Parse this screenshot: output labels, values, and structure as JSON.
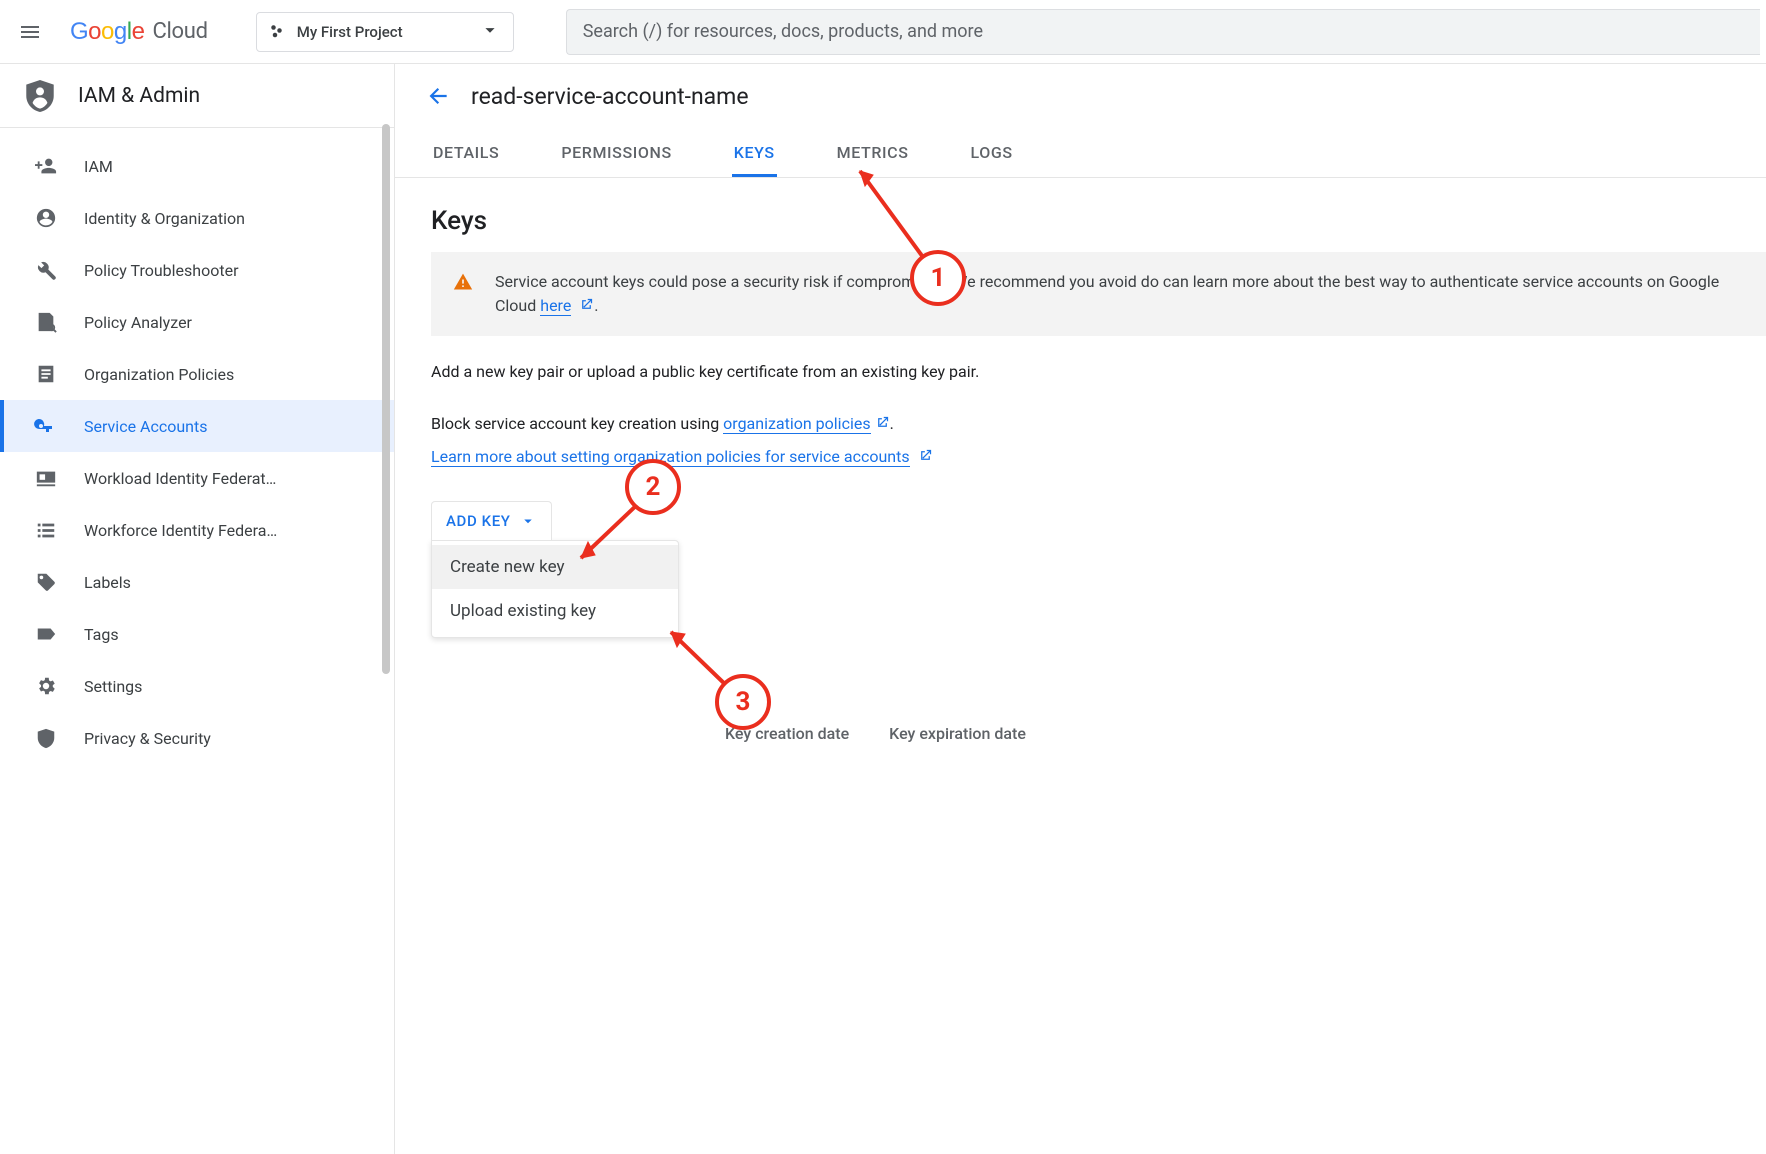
{
  "header": {
    "logo_text_google": "Google",
    "logo_text_cloud": "Cloud",
    "project_label": "My First Project",
    "search_placeholder": "Search (/) for resources, docs, products, and more"
  },
  "section": {
    "title": "IAM & Admin"
  },
  "sidebar": {
    "items": [
      {
        "label": "IAM"
      },
      {
        "label": "Identity & Organization"
      },
      {
        "label": "Policy Troubleshooter"
      },
      {
        "label": "Policy Analyzer"
      },
      {
        "label": "Organization Policies"
      },
      {
        "label": "Service Accounts"
      },
      {
        "label": "Workload Identity Federat…"
      },
      {
        "label": "Workforce Identity Federa…"
      },
      {
        "label": "Labels"
      },
      {
        "label": "Tags"
      },
      {
        "label": "Settings"
      },
      {
        "label": "Privacy & Security"
      }
    ]
  },
  "page": {
    "title": "read-service-account-name"
  },
  "tabs": [
    {
      "label": "DETAILS"
    },
    {
      "label": "PERMISSIONS"
    },
    {
      "label": "KEYS"
    },
    {
      "label": "METRICS"
    },
    {
      "label": "LOGS"
    }
  ],
  "keys": {
    "heading": "Keys",
    "alert": "Service account keys could pose a security risk if compromised. We recommend you avoid do can learn more about the best way to authenticate service accounts on Google Cloud ",
    "alert_link": "here",
    "intro": "Add a new key pair or upload a public key certificate from an existing key pair.",
    "block_prefix": "Block service account key creation using ",
    "block_link": "organization policies",
    "learn_more_link": "Learn more about setting organization policies for service accounts",
    "add_key_label": "ADD KEY",
    "menu_create": "Create new key",
    "menu_upload": "Upload existing key",
    "col_creation": "Key creation date",
    "col_expiration": "Key expiration date"
  },
  "annotations": {
    "n1": "1",
    "n2": "2",
    "n3": "3"
  }
}
